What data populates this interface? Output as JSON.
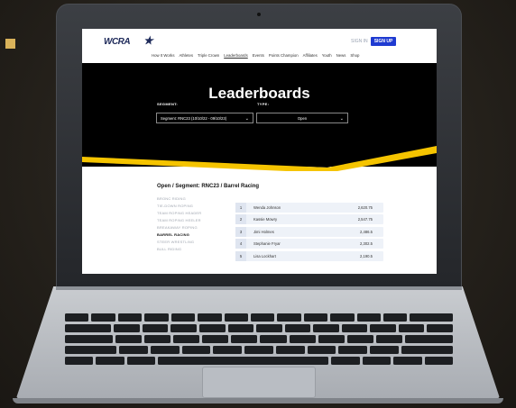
{
  "site": {
    "logo_text": "WCRA",
    "sign_in": "SIGN IN",
    "sign_up": "SIGN UP",
    "nav": [
      "How It Works",
      "Athletes",
      "Triple Crown",
      "Leaderboards",
      "Events",
      "Points Champion",
      "Affiliates",
      "Youth",
      "News",
      "Shop"
    ],
    "active_nav": "Leaderboards"
  },
  "hero": {
    "title": "Leaderboards",
    "segment_label": "SEGMENT:",
    "segment_value": "Segment: RNC23 (10/10/22 - 09/10/23)",
    "type_label": "TYPE:",
    "type_value": "Open"
  },
  "leaderboard": {
    "section_title": "Open / Segment: RNC23 / Barrel Racing",
    "events": [
      "BRONC RIDING",
      "TIE-DOWN ROPING",
      "TEAM ROPING HEADER",
      "TEAM ROPING HEELER",
      "BREAKAWAY ROPING",
      "BARREL RACING",
      "STEER WRESTLING",
      "BULL RIDING"
    ],
    "current_event": "BARREL RACING",
    "rows": [
      {
        "rank": "1",
        "name": "Wenda Johnson",
        "score": "2,620.75"
      },
      {
        "rank": "2",
        "name": "Kassie Mowry",
        "score": "2,547.75"
      },
      {
        "rank": "3",
        "name": "Jimi Holmes",
        "score": "2,486.5"
      },
      {
        "rank": "4",
        "name": "Stephanie Fryar",
        "score": "2,302.5"
      },
      {
        "rank": "5",
        "name": "Lisa Lockhart",
        "score": "2,190.5"
      }
    ]
  },
  "colors": {
    "accent": "#d9b25a",
    "stripe_yellow": "#f5c400",
    "signup_blue": "#1f3bd1",
    "hero_black": "#000000"
  }
}
